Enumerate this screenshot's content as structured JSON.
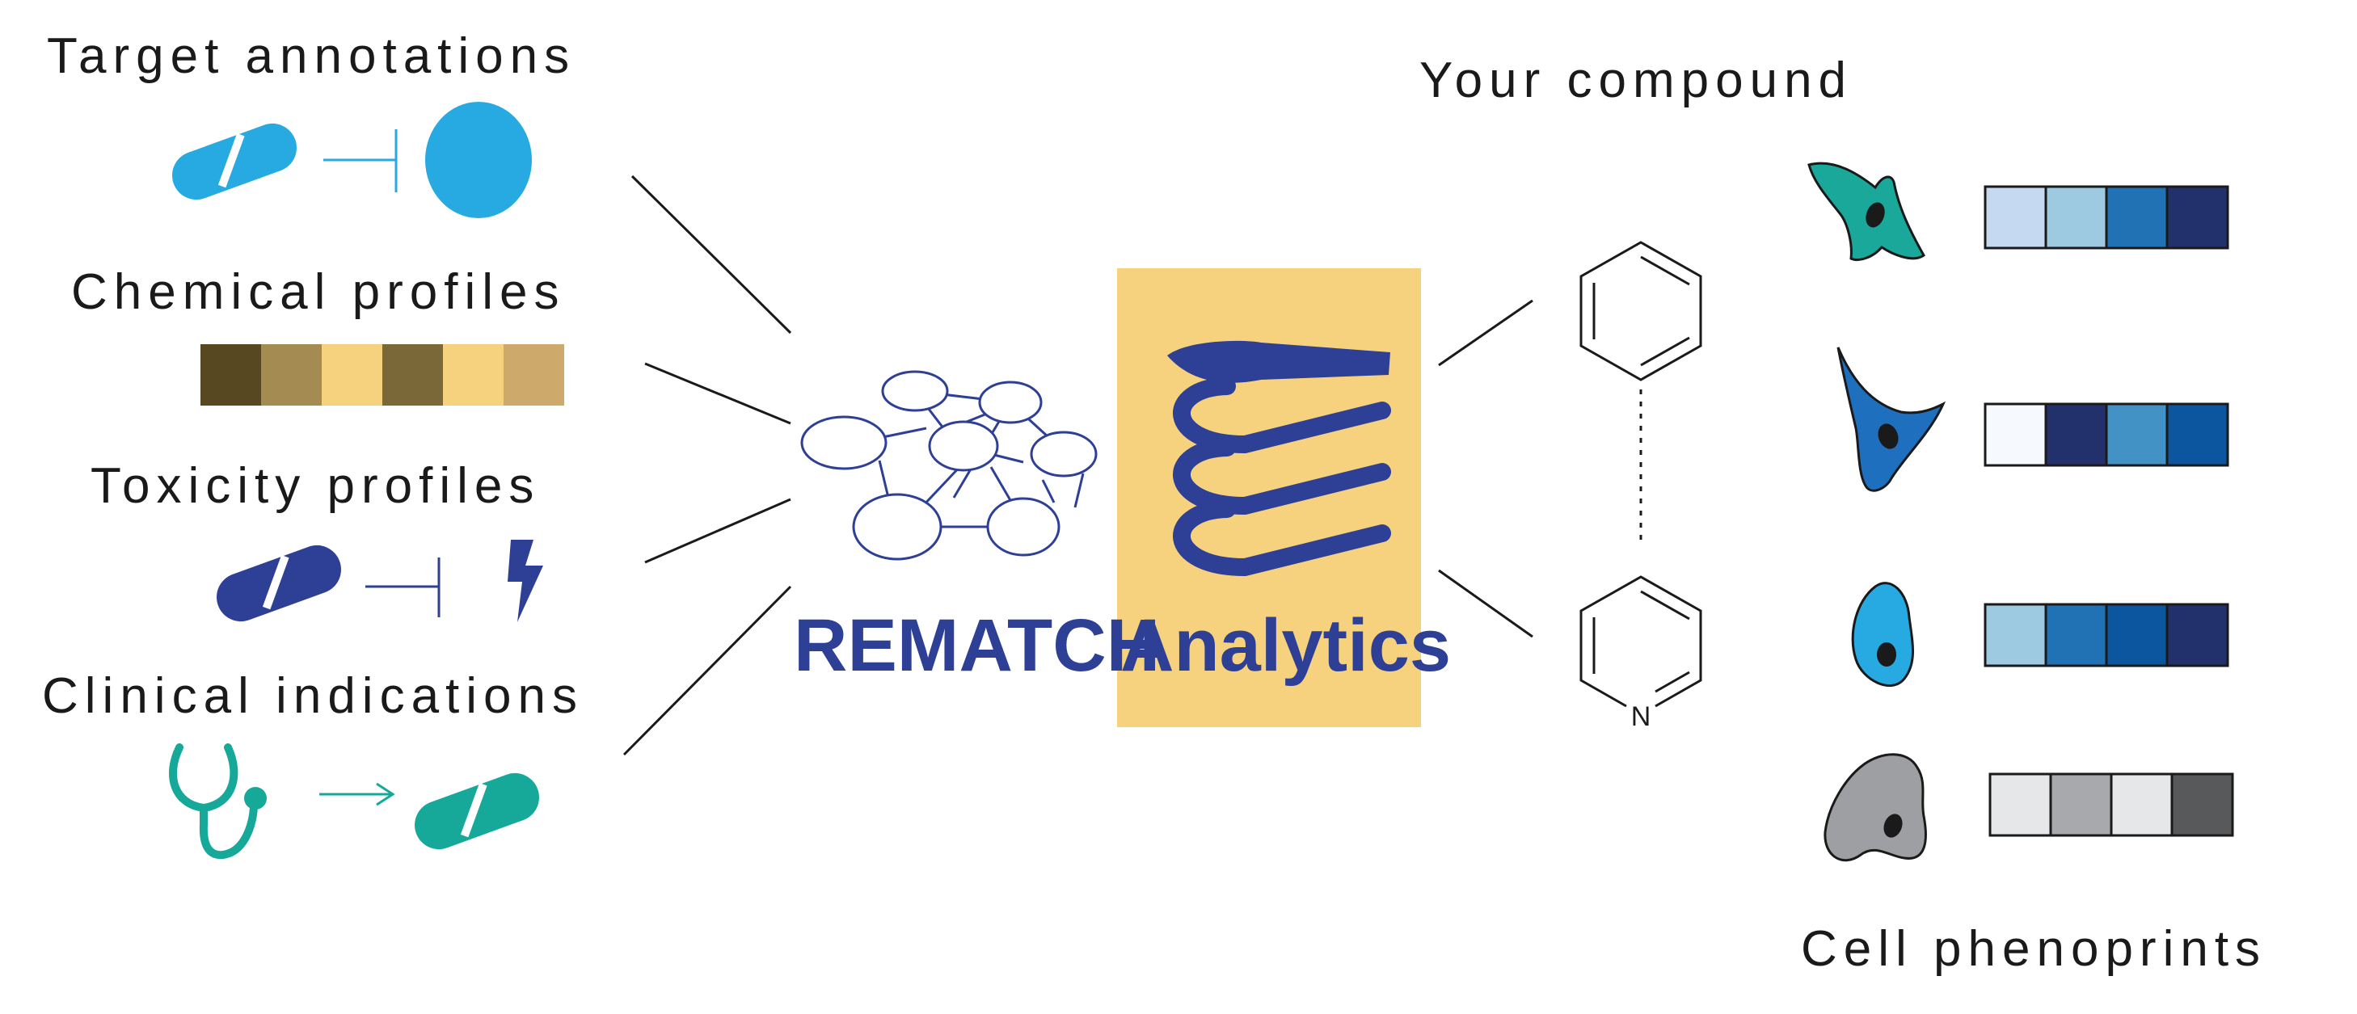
{
  "sections": {
    "target": "Target annotations",
    "chemical": "Chemical profiles",
    "toxicity": "Toxicity profiles",
    "clinical": "Clinical indications"
  },
  "brand": {
    "part1": "REMATCH",
    "part2": "Analytics"
  },
  "compound": {
    "title": "Your compound",
    "n_label": "N"
  },
  "phenoprints_title": "Cell phenoprints",
  "colors": {
    "brand_blue": "#2e3f96",
    "panel_yellow": "#f6d27e",
    "cyan": "#27aae1",
    "navy": "#2e3f96",
    "teal": "#16a99a",
    "line": "#1a1a1a"
  },
  "chemical_profile_swatches": [
    "#574822",
    "#a38b52",
    "#f6d27e",
    "#7b6838",
    "#f6d27e",
    "#cdaa6b"
  ],
  "phenoprint_rows": [
    {
      "cell": "teal-spiky-cell-icon",
      "cell_color": "#1aa89a",
      "swatches": [
        "#c5daf0",
        "#9ecae1",
        "#2171b5",
        "#22316b"
      ]
    },
    {
      "cell": "blue-triangle-cell-icon",
      "cell_color": "#1f6fbf",
      "swatches": [
        "#f6fafe",
        "#22316b",
        "#4292c6",
        "#0c56a0"
      ]
    },
    {
      "cell": "blue-oval-cell-icon",
      "cell_color": "#27aae1",
      "swatches": [
        "#9ecae1",
        "#2171b5",
        "#0c56a0",
        "#22316b"
      ]
    },
    {
      "cell": "gray-cell-icon",
      "cell_color": "#9d9fa2",
      "swatches": [
        "#e6e7e8",
        "#a7a9ac",
        "#e6e7e8",
        "#58595b"
      ]
    }
  ]
}
